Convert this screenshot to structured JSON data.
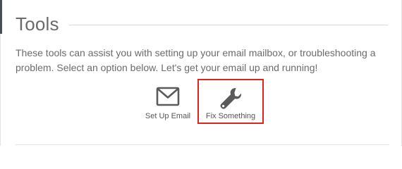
{
  "section": {
    "title": "Tools",
    "description": "These tools can assist you with setting up your email mailbox, or troubleshooting a problem. Select an option below. Let's get your email up and running!"
  },
  "tools": [
    {
      "label": "Set Up Email",
      "icon": "envelope-icon",
      "selected": false
    },
    {
      "label": "Fix Something",
      "icon": "wrench-icon",
      "selected": true
    }
  ],
  "colors": {
    "text": "#6b6b6b",
    "icon": "#5a5a5a",
    "highlight": "#e0221a",
    "accent": "#4a4f55"
  }
}
